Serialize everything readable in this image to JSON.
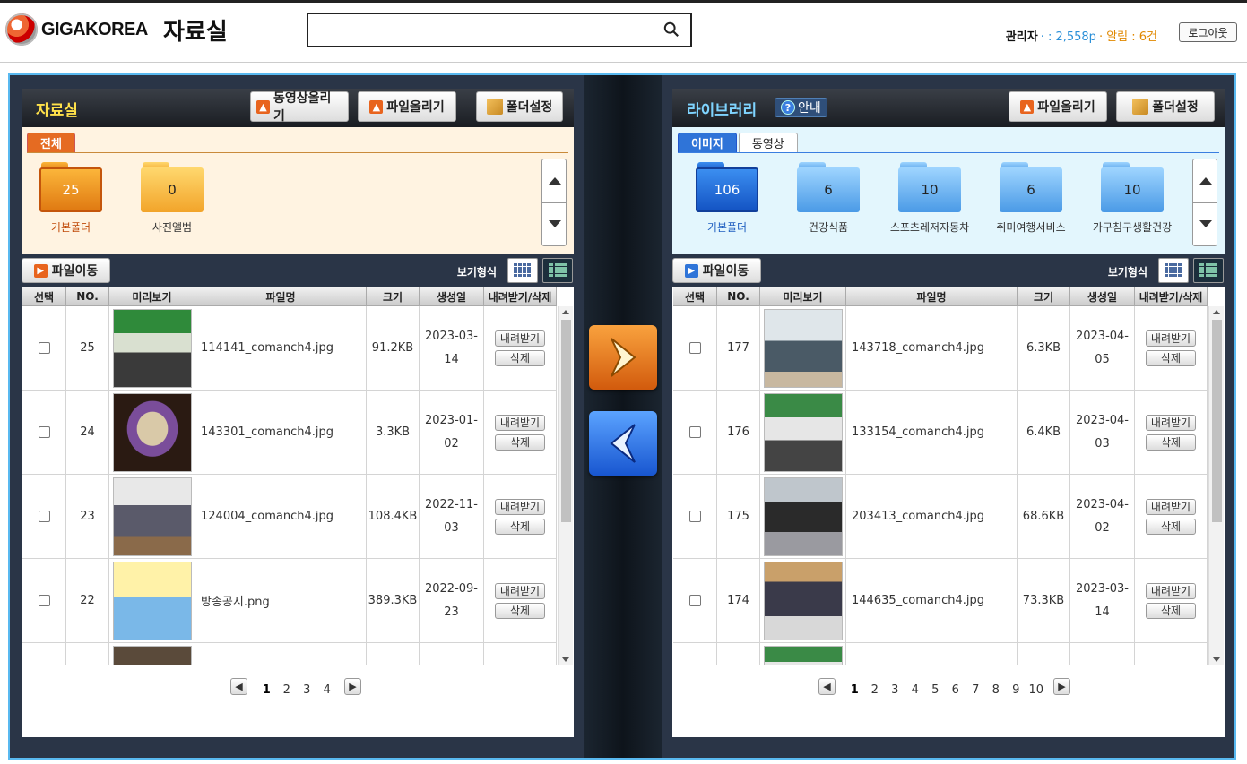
{
  "header": {
    "logo_text": "GIGAKOREA",
    "site_title": "자료실",
    "search_placeholder": "",
    "user_name": "관리자",
    "user_points": "· : 2,558p",
    "user_alerts": "· 알림 : 6건",
    "logout_label": "로그아웃"
  },
  "left": {
    "title": "자료실",
    "btn_video_upload": "동영상올리기",
    "btn_file_upload": "파일올리기",
    "btn_folder_settings": "폴더설정",
    "tabs": [
      "전체"
    ],
    "folders": [
      {
        "count": "25",
        "label": "기본폴더"
      },
      {
        "count": "0",
        "label": "사진앨범"
      }
    ],
    "move_label": "파일이동",
    "view_label": "보기형식",
    "columns": [
      "선택",
      "NO.",
      "미리보기",
      "파일명",
      "크기",
      "생성일",
      "내려받기/삭제"
    ],
    "rows": [
      {
        "no": "25",
        "file": "114141_comanch4.jpg",
        "size": "91.2KB",
        "date1": "2023-03-",
        "date2": "14"
      },
      {
        "no": "24",
        "file": "143301_comanch4.jpg",
        "size": "3.3KB",
        "date1": "2023-01-",
        "date2": "02"
      },
      {
        "no": "23",
        "file": "124004_comanch4.jpg",
        "size": "108.4KB",
        "date1": "2022-11-",
        "date2": "03"
      },
      {
        "no": "22",
        "file": "방송공지.png",
        "size": "389.3KB",
        "date1": "2022-09-",
        "date2": "23"
      }
    ],
    "pages": [
      "1",
      "2",
      "3",
      "4"
    ]
  },
  "right": {
    "title": "라이브러리",
    "help_label": "안내",
    "btn_file_upload": "파일올리기",
    "btn_folder_settings": "폴더설정",
    "tabs": [
      "이미지",
      "동영상"
    ],
    "folders": [
      {
        "count": "106",
        "label": "기본폴더"
      },
      {
        "count": "6",
        "label": "건강식품"
      },
      {
        "count": "10",
        "label": "스포츠레저자동차"
      },
      {
        "count": "6",
        "label": "취미여행서비스"
      },
      {
        "count": "10",
        "label": "가구침구생활건강"
      }
    ],
    "move_label": "파일이동",
    "view_label": "보기형식",
    "columns": [
      "선택",
      "NO.",
      "미리보기",
      "파일명",
      "크기",
      "생성일",
      "내려받기/삭제"
    ],
    "rows": [
      {
        "no": "177",
        "file": "143718_comanch4.jpg",
        "size": "6.3KB",
        "date1": "2023-04-",
        "date2": "05"
      },
      {
        "no": "176",
        "file": "133154_comanch4.jpg",
        "size": "6.4KB",
        "date1": "2023-04-",
        "date2": "03"
      },
      {
        "no": "175",
        "file": "203413_comanch4.jpg",
        "size": "68.6KB",
        "date1": "2023-04-",
        "date2": "02"
      },
      {
        "no": "174",
        "file": "144635_comanch4.jpg",
        "size": "73.3KB",
        "date1": "2023-03-",
        "date2": "14"
      }
    ],
    "pages": [
      "1",
      "2",
      "3",
      "4",
      "5",
      "6",
      "7",
      "8",
      "9",
      "10"
    ]
  },
  "row_actions": {
    "download": "내려받기",
    "delete": "삭제"
  },
  "colors": {
    "accent_orange": "#e56b22",
    "accent_blue": "#2f74d8",
    "frame": "#2a3547",
    "frame_border": "#59b9f0"
  }
}
